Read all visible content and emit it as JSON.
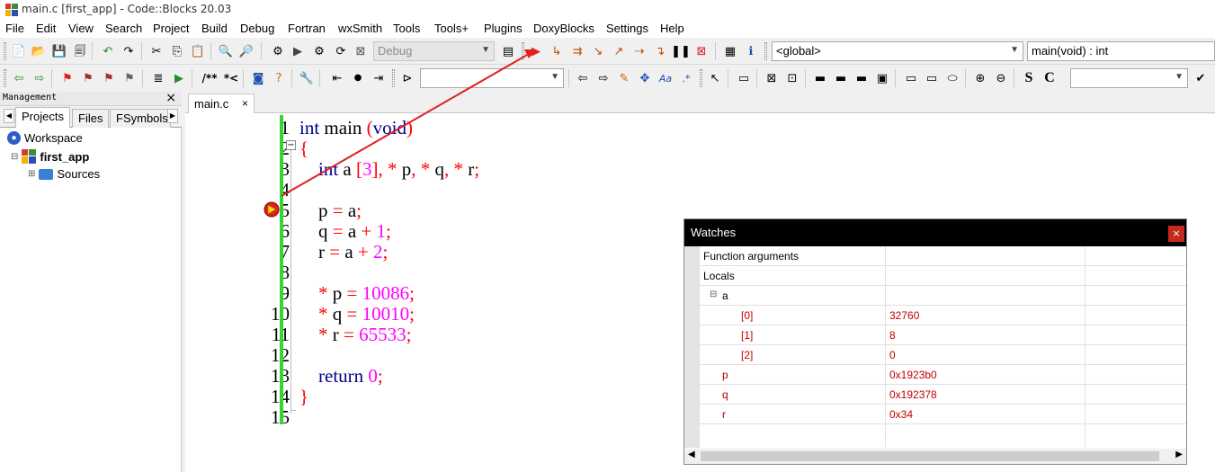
{
  "window": {
    "title": "main.c [first_app] - Code::Blocks 20.03"
  },
  "menu": [
    "File",
    "Edit",
    "View",
    "Search",
    "Project",
    "Build",
    "Debug",
    "Fortran",
    "wxSmith",
    "Tools",
    "Tools+",
    "Plugins",
    "DoxyBlocks",
    "Settings",
    "Help"
  ],
  "toolbar": {
    "build_target": "Debug",
    "scope": "<global>",
    "function": "main(void) : int",
    "doxy_comment_block": "/**",
    "doxy_line_comment": "*<",
    "search_text": ""
  },
  "management": {
    "title": "Management",
    "tabs": [
      "Projects",
      "Files",
      "FSymbols"
    ],
    "tree": {
      "workspace": "Workspace",
      "project": "first_app",
      "folder": "Sources"
    }
  },
  "editor": {
    "tab": "main.c",
    "line_numbers": [
      "1",
      "2",
      "3",
      "4",
      "5",
      "6",
      "7",
      "8",
      "9",
      "10",
      "11",
      "12",
      "13",
      "14",
      "15"
    ],
    "breakpoint_line": 5
  },
  "watches": {
    "title": "Watches",
    "rows": [
      {
        "name": "Function arguments",
        "value": "",
        "indent": 0,
        "expander": ""
      },
      {
        "name": "Locals",
        "value": "",
        "indent": 0,
        "expander": "⊟"
      },
      {
        "name": "a",
        "value": "",
        "indent": 1,
        "expander": "⊟"
      },
      {
        "name": "[0]",
        "value": "32760",
        "indent": 2,
        "expander": ""
      },
      {
        "name": "[1]",
        "value": "8",
        "indent": 2,
        "expander": ""
      },
      {
        "name": "[2]",
        "value": "0",
        "indent": 2,
        "expander": ""
      },
      {
        "name": "p",
        "value": "0x1923b0",
        "indent": 1,
        "expander": ""
      },
      {
        "name": "q",
        "value": "0x192378",
        "indent": 1,
        "expander": ""
      },
      {
        "name": "r",
        "value": "0x34",
        "indent": 1,
        "expander": ""
      }
    ]
  },
  "colors": {
    "keyword": "#00008b",
    "number": "#ff00ff",
    "operator": "#ff0000",
    "changebar": "#33d633",
    "arrow": "#e02020"
  }
}
